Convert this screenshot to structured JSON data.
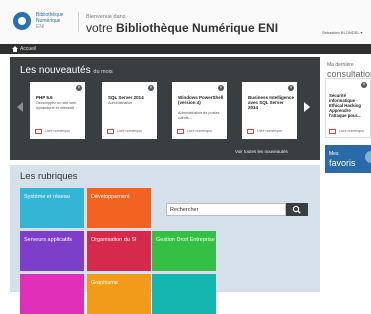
{
  "header": {
    "logo_line1": "Bibliothèque",
    "logo_line2": "Numérique",
    "logo_line3": "ENI",
    "welcome": "Bienvenue dans",
    "title_prefix": "votre ",
    "title_bold": "Bibliothèque Numérique ENI",
    "user": "Sébastien BLONDEL ▾"
  },
  "nav": {
    "home_label": "Accueil"
  },
  "nouveautes": {
    "title": "Les nouveautés",
    "subtitle": "du mois",
    "voir_toutes": "Voir toutes les nouveautés",
    "books": [
      {
        "title": "PHP 5.6",
        "desc": "Développez un site web dynamique et interactif",
        "footer": "Livre numérique"
      },
      {
        "title": "SQL Server 2014",
        "desc": "Administration",
        "footer": "Livre numérique"
      },
      {
        "title": "Windows PowerShell (version 4)",
        "desc": "Administration de postes clients...",
        "footer": "Livre numérique"
      },
      {
        "title": "Business Intelligence avec SQL Server 2014",
        "desc": "",
        "footer": "Livre numérique"
      }
    ]
  },
  "consultation": {
    "line1": "Ma dernière",
    "line2": "consultation",
    "book_title": "Sécurité informatique - Ethical Hacking Apprendre l'attaque pour...",
    "book_footer": "Livre numérique"
  },
  "favoris": {
    "line1": "Mes",
    "line2": "favoris"
  },
  "rubriques": {
    "title": "Les rubriques",
    "search_placeholder": "Rechercher",
    "tiles": [
      {
        "label": "Système et réseau",
        "color": "#35b5d5"
      },
      {
        "label": "Développement",
        "color": "#f2631f"
      },
      {
        "label": "Serveurs applicatifs",
        "color": "#7b3fc8"
      },
      {
        "label": "Organisation du SI",
        "color": "#d52a4b"
      },
      {
        "label": "Gestion Droit Entreprise",
        "color": "#36bf45"
      },
      {
        "label": "",
        "color": "#e02fb9"
      },
      {
        "label": "Graphisme",
        "color": "#f29a1a"
      },
      {
        "label": "",
        "color": "#16b6b0"
      }
    ]
  },
  "colors": {
    "accent_blue": "#2b6aa8",
    "dark_panel": "#3b3e41"
  }
}
